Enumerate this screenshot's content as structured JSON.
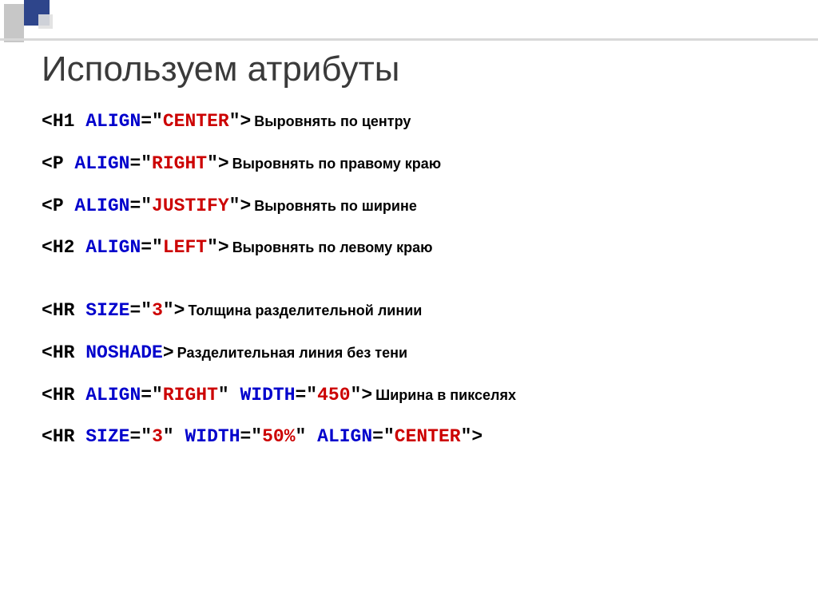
{
  "title": "Используем атрибуты",
  "rows": [
    {
      "code": [
        {
          "t": "<",
          "c": "b-black"
        },
        {
          "t": "H1 ",
          "c": "b-black"
        },
        {
          "t": "ALIGN",
          "c": "b-blue"
        },
        {
          "t": "=\"",
          "c": "b-black"
        },
        {
          "t": "CENTER",
          "c": "b-red"
        },
        {
          "t": "\">",
          "c": "b-black"
        }
      ],
      "desc": "Выровнять по центру"
    },
    {
      "code": [
        {
          "t": "<",
          "c": "b-black"
        },
        {
          "t": "P ",
          "c": "b-black"
        },
        {
          "t": "ALIGN",
          "c": "b-blue"
        },
        {
          "t": "=\"",
          "c": "b-black"
        },
        {
          "t": "RIGHT",
          "c": "b-red"
        },
        {
          "t": "\">",
          "c": "b-black"
        }
      ],
      "desc": "Выровнять по правому краю"
    },
    {
      "code": [
        {
          "t": "<",
          "c": "b-black"
        },
        {
          "t": "P ",
          "c": "b-black"
        },
        {
          "t": "ALIGN",
          "c": "b-blue"
        },
        {
          "t": "=\"",
          "c": "b-black"
        },
        {
          "t": "JUSTIFY",
          "c": "b-red"
        },
        {
          "t": "\">",
          "c": "b-black"
        }
      ],
      "desc": "Выровнять по ширине"
    },
    {
      "code": [
        {
          "t": "<",
          "c": "b-black"
        },
        {
          "t": "H2 ",
          "c": "b-black"
        },
        {
          "t": "ALIGN",
          "c": "b-blue"
        },
        {
          "t": "=\"",
          "c": "b-black"
        },
        {
          "t": "LEFT",
          "c": "b-red"
        },
        {
          "t": "\">",
          "c": "b-black"
        }
      ],
      "desc": "Выровнять по левому краю"
    },
    {
      "gap": true,
      "code": [
        {
          "t": "<",
          "c": "b-black"
        },
        {
          "t": "HR ",
          "c": "b-black"
        },
        {
          "t": "SIZE",
          "c": "b-blue"
        },
        {
          "t": "=\"",
          "c": "b-black"
        },
        {
          "t": "3",
          "c": "b-red"
        },
        {
          "t": "\">",
          "c": "b-black"
        }
      ],
      "desc": "Толщина разделительной линии"
    },
    {
      "code": [
        {
          "t": "<",
          "c": "b-black"
        },
        {
          "t": "HR ",
          "c": "b-black"
        },
        {
          "t": "NOSHADE",
          "c": "b-blue"
        },
        {
          "t": ">",
          "c": "b-black"
        }
      ],
      "desc": "Разделительная линия без тени"
    },
    {
      "code": [
        {
          "t": "<",
          "c": "b-black"
        },
        {
          "t": "HR ",
          "c": "b-black"
        },
        {
          "t": "ALIGN",
          "c": "b-blue"
        },
        {
          "t": "=\"",
          "c": "b-black"
        },
        {
          "t": "RIGHT",
          "c": "b-red"
        },
        {
          "t": "\" ",
          "c": "b-black"
        },
        {
          "t": "WIDTH",
          "c": "b-blue"
        },
        {
          "t": "=\"",
          "c": "b-black"
        },
        {
          "t": "450",
          "c": "b-red"
        },
        {
          "t": "\">",
          "c": "b-black"
        }
      ],
      "desc": "Ширина в пикселях"
    },
    {
      "code": [
        {
          "t": "<",
          "c": "b-black"
        },
        {
          "t": "HR ",
          "c": "b-black"
        },
        {
          "t": "SIZE",
          "c": "b-blue"
        },
        {
          "t": "=\"",
          "c": "b-black"
        },
        {
          "t": "3",
          "c": "b-red"
        },
        {
          "t": "\" ",
          "c": "b-black"
        },
        {
          "t": "WIDTH",
          "c": "b-blue"
        },
        {
          "t": "=\"",
          "c": "b-black"
        },
        {
          "t": "50%",
          "c": "b-red"
        },
        {
          "t": "\" ",
          "c": "b-black"
        },
        {
          "t": "ALIGN",
          "c": "b-blue"
        },
        {
          "t": "=\"",
          "c": "b-black"
        },
        {
          "t": "CENTER",
          "c": "b-red"
        },
        {
          "t": "\">",
          "c": "b-black"
        }
      ],
      "desc": ""
    }
  ]
}
